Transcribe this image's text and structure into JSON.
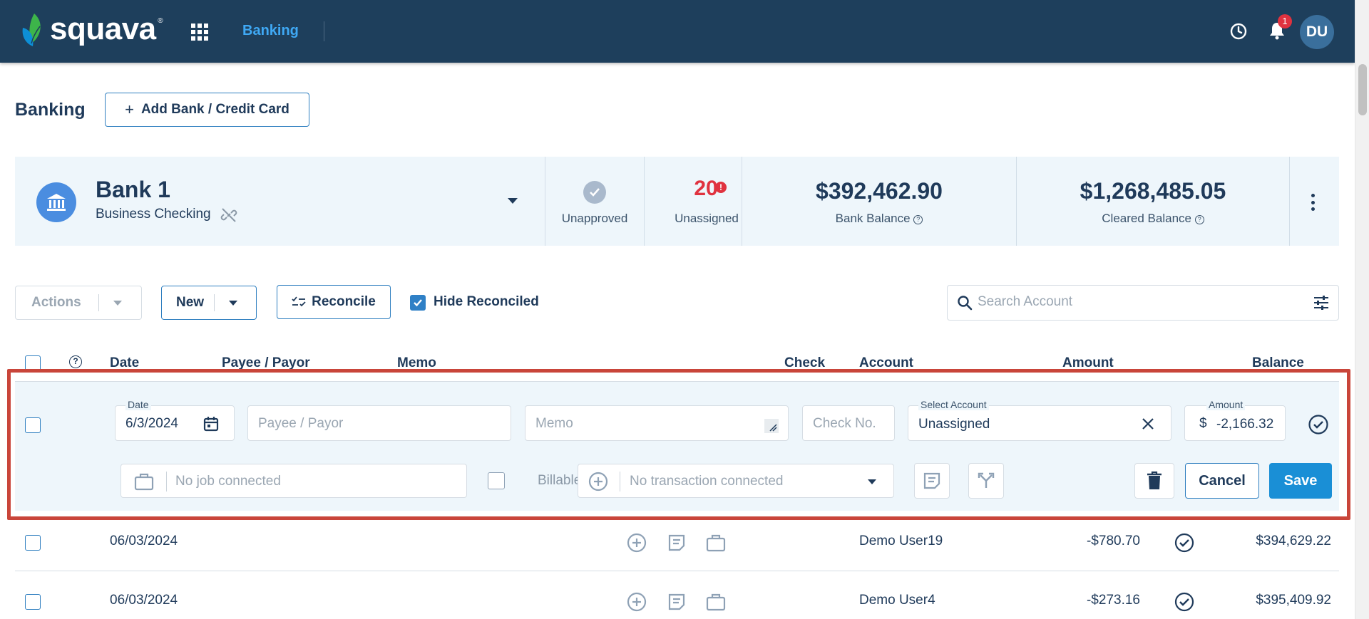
{
  "nav": {
    "brand": "squava",
    "brand_mark": "®",
    "current_app": "Banking",
    "notification_count": "1",
    "user_initials": "DU"
  },
  "page": {
    "title": "Banking",
    "add_bank_label": "Add Bank / Credit Card"
  },
  "bank": {
    "name": "Bank 1",
    "type": "Business Checking",
    "unapproved_label": "Unapproved",
    "unassigned_count": "20",
    "unassigned_label": "Unassigned",
    "bank_balance": "$392,462.90",
    "bank_balance_label": "Bank Balance",
    "cleared_balance": "$1,268,485.05",
    "cleared_balance_label": "Cleared Balance"
  },
  "toolbar": {
    "actions_label": "Actions",
    "new_label": "New",
    "reconcile_label": "Reconcile",
    "hide_reconciled_label": "Hide Reconciled",
    "hide_reconciled_checked": true,
    "search_placeholder": "Search Account"
  },
  "table": {
    "columns": [
      "Date",
      "Payee / Payor",
      "Memo",
      "Check",
      "Account",
      "Amount",
      "Balance"
    ]
  },
  "edit_row": {
    "date_label": "Date",
    "date_value": "6/3/2024",
    "payee_placeholder": "Payee / Payor",
    "memo_placeholder": "Memo",
    "check_placeholder": "Check No.",
    "account_label": "Select Account",
    "account_value": "Unassigned",
    "amount_label": "Amount",
    "currency_symbol": "$",
    "amount_value": "-2,166.32",
    "job_placeholder": "No job connected",
    "billable_label": "Billable",
    "transaction_placeholder": "No transaction connected",
    "cancel_label": "Cancel",
    "save_label": "Save"
  },
  "rows": [
    {
      "date": "06/03/2024",
      "account": "Demo User19",
      "amount": "-$780.70",
      "balance": "$394,629.22"
    },
    {
      "date": "06/03/2024",
      "account": "Demo User4",
      "amount": "-$273.16",
      "balance": "$395,409.92"
    }
  ],
  "colors": {
    "nav_bg": "#1e3f5c",
    "accent": "#2f80c6",
    "save_bg": "#1a8fd6",
    "alert": "#e0323f",
    "highlight_border": "#c9453a",
    "card_bg": "#eef6fb"
  }
}
